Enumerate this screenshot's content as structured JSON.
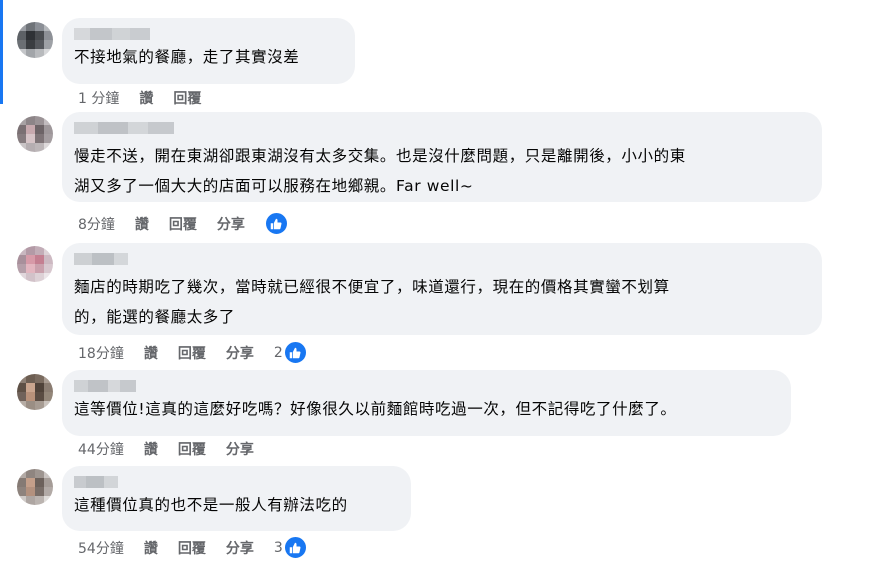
{
  "comments": [
    {
      "text": "不接地氣的餐廳，走了其實沒差",
      "time": "1 分鐘",
      "like_label": "讚",
      "reply_label": "回覆",
      "share_label": "",
      "like_count": ""
    },
    {
      "text": "慢走不送，開在東湖卻跟東湖沒有太多交集。也是沒什麼問題，只是離開後，小小的東\n湖又多了一個大大的店面可以服務在地鄉親。Far well~",
      "time": "8分鐘",
      "like_label": "讚",
      "reply_label": "回覆",
      "share_label": "分享",
      "like_count": ""
    },
    {
      "text": "麵店的時期吃了幾次，當時就已經很不便宜了，味道還行，現在的價格其實蠻不划算\n的，能選的餐廳太多了",
      "time": "18分鐘",
      "like_label": "讚",
      "reply_label": "回覆",
      "share_label": "分享",
      "like_count": "2"
    },
    {
      "text": "這等價位!這真的這麼好吃嗎？好像很久以前麵館時吃過一次，但不記得吃了什麼了。",
      "time": "44分鐘",
      "like_label": "讚",
      "reply_label": "回覆",
      "share_label": "分享",
      "like_count": ""
    },
    {
      "text": "這種價位真的也不是一般人有辦法吃的",
      "time": "54分鐘",
      "like_label": "讚",
      "reply_label": "回覆",
      "share_label": "分享",
      "like_count": "3"
    }
  ],
  "colors": {
    "accent": "#1877f2",
    "bubble": "#f0f2f5",
    "meta_text": "#65676b"
  },
  "icons": {
    "like": "thumbs-up-icon"
  }
}
